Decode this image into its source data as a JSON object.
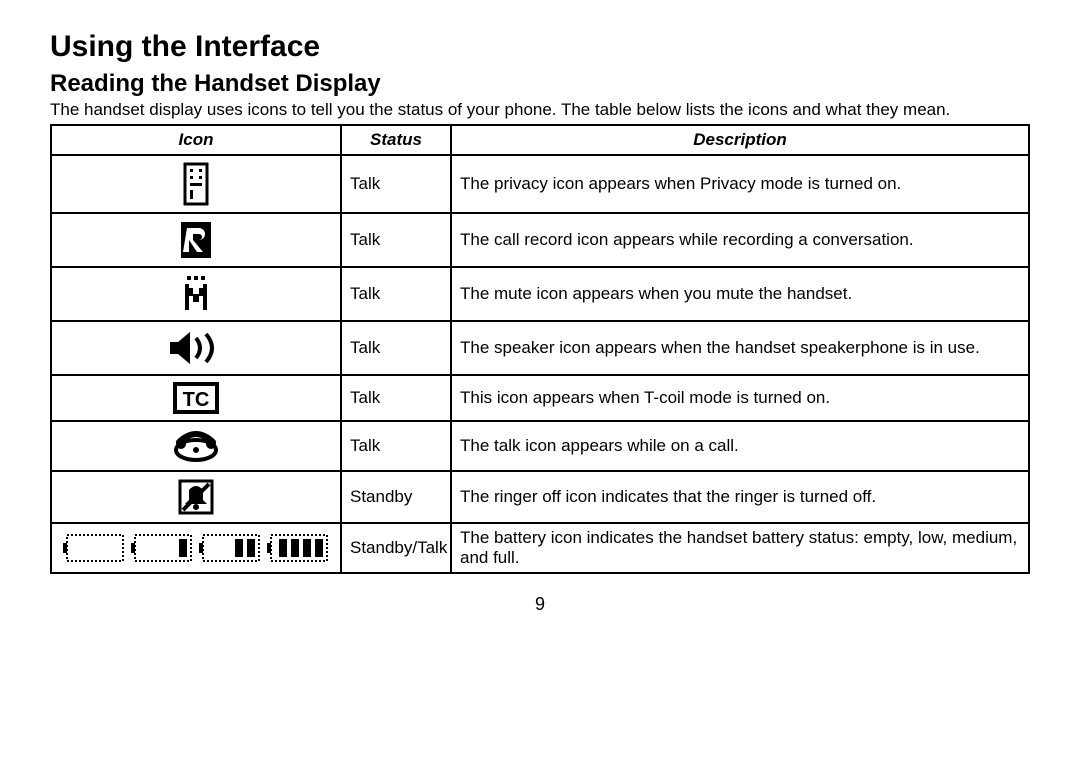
{
  "heading": "Using the Interface",
  "subheading": "Reading the Handset Display",
  "intro": "The handset display uses icons to tell you the status of your phone. The table below lists the icons and what they mean.",
  "columns": {
    "icon": "Icon",
    "status": "Status",
    "description": "Description"
  },
  "rows": [
    {
      "icon_name": "privacy-icon",
      "status": "Talk",
      "description": "The privacy icon appears when Privacy mode is turned on."
    },
    {
      "icon_name": "record-icon",
      "status": "Talk",
      "description": "The call record icon appears while recording a conversation."
    },
    {
      "icon_name": "mute-icon",
      "status": "Talk",
      "description": "The mute icon appears when you mute the handset."
    },
    {
      "icon_name": "speaker-icon",
      "status": "Talk",
      "description": "The speaker icon appears when the handset speakerphone is in use."
    },
    {
      "icon_name": "tcoil-icon",
      "status": "Talk",
      "description": "This icon appears when T-coil mode is turned on."
    },
    {
      "icon_name": "talk-icon",
      "status": "Talk",
      "description": "The talk icon appears while on a call."
    },
    {
      "icon_name": "ringer-off-icon",
      "status": "Standby",
      "description": "The ringer off icon indicates that the ringer is turned off."
    },
    {
      "icon_name": "battery-icon",
      "status": "Standby/Talk",
      "description": "The battery icon indicates the handset battery status: empty, low, medium, and full."
    }
  ],
  "page_number": "9"
}
